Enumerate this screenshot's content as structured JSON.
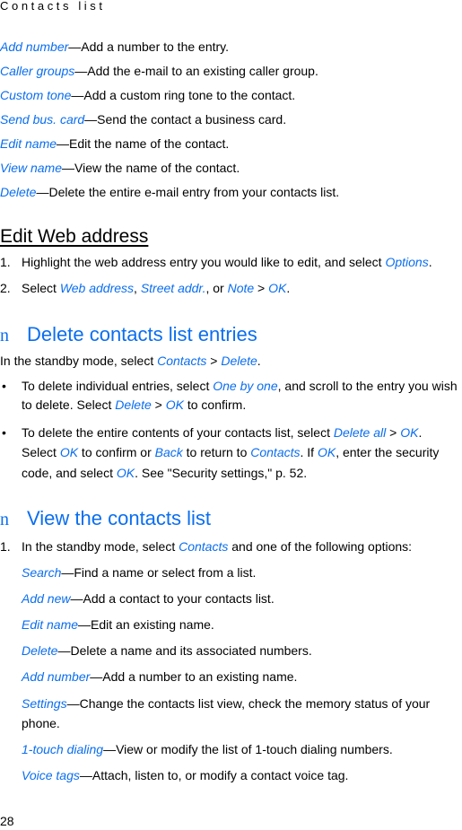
{
  "running_head": "Contacts list",
  "email_options": [
    {
      "term": "Add number",
      "desc": "—Add a number to the entry."
    },
    {
      "term": "Caller groups",
      "desc": "—Add the e-mail to an existing caller group."
    },
    {
      "term": "Custom tone",
      "desc": "—Add a custom ring tone to the contact."
    },
    {
      "term": "Send bus. card",
      "desc": "—Send the contact a business card."
    },
    {
      "term": "Edit name",
      "desc": "—Edit the name of the contact."
    },
    {
      "term": "View name",
      "desc": "—View the name of the contact."
    },
    {
      "term": "Delete",
      "desc": "—Delete the entire e-mail entry from your contacts list."
    }
  ],
  "edit_web": {
    "heading": "Edit Web address",
    "step1": {
      "num": "1.",
      "text": "Highlight the web address entry you would like to edit, and select ",
      "link": "Options",
      "end": "."
    },
    "step2": {
      "num": "2.",
      "pre": "Select ",
      "l1": "Web address",
      "s1": ", ",
      "l2": "Street addr.",
      "s2": ", or ",
      "l3": "Note",
      "s3": " > ",
      "l4": "OK",
      "end": "."
    }
  },
  "delete_section": {
    "bullet": "n",
    "heading": "Delete contacts list entries",
    "intro": {
      "pre": "In the standby mode, select ",
      "l1": "Contacts",
      "s1": " > ",
      "l2": "Delete",
      "end": "."
    },
    "b1": {
      "line1_pre": "To delete individual entries, select ",
      "line1_link": "One by one",
      "line1_post": ", and scroll to the entry you wish",
      "line2_pre": "to delete. Select ",
      "line2_l1": "Delete",
      "line2_s1": " > ",
      "line2_l2": "OK",
      "line2_post": " to confirm."
    },
    "b2": {
      "line1_pre": "To delete the entire contents of your contacts list, select ",
      "line1_l1": "Delete all",
      "line1_s1": " > ",
      "line1_l2": "OK",
      "line1_post": ".",
      "line2_pre": "Select ",
      "line2_l1": "OK",
      "line2_s1": " to confirm or ",
      "line2_l2": "Back",
      "line2_s2": " to return to ",
      "line2_l3": "Contacts",
      "line2_s3": ". If ",
      "line2_l4": "OK",
      "line2_post": ", enter the security",
      "line3_pre": "code, and select ",
      "line3_l1": "OK",
      "line3_post": ". See \"Security settings,\" p. 52."
    }
  },
  "view_section": {
    "bullet": "n",
    "heading": "View the contacts list",
    "step1": {
      "num": "1.",
      "pre": "In the standby mode, select ",
      "link": "Contacts",
      "post": " and one of the following options:"
    },
    "options": [
      {
        "term": "Search",
        "desc": "—Find a name or select from a list."
      },
      {
        "term": "Add new",
        "desc": "—Add a contact to your contacts list."
      },
      {
        "term": "Edit name",
        "desc": "—Edit an existing name."
      },
      {
        "term": "Delete",
        "desc": "—Delete a name and its associated numbers."
      },
      {
        "term": "Add number",
        "desc": "—Add a number to an existing name."
      },
      {
        "term": "Settings",
        "desc": "—Change the contacts list view, check the memory status of your",
        "desc2": "phone."
      },
      {
        "term": "1-touch dialing",
        "desc": "—View or modify the list of 1-touch dialing numbers."
      },
      {
        "term": "Voice tags",
        "desc": "—Attach, listen to, or modify a contact voice tag."
      }
    ]
  },
  "page_number": "28",
  "colors": {
    "accent": "#0a6ef0",
    "text": "#000000"
  }
}
